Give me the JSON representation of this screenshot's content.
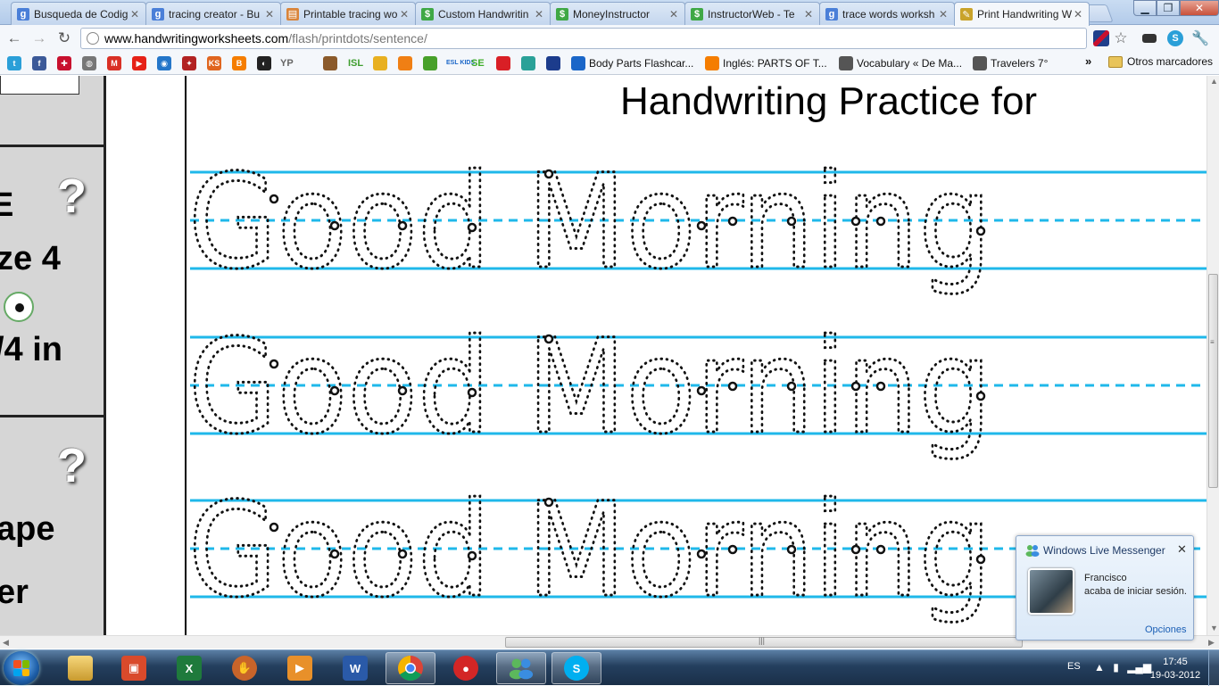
{
  "browser": {
    "tabs": [
      {
        "label": "Busqueda de Codig",
        "icon": "google-icon",
        "color": "#4a7fd8"
      },
      {
        "label": "tracing creator - Bu",
        "icon": "google-icon",
        "color": "#4a7fd8"
      },
      {
        "label": "Printable tracing wo",
        "icon": "worksheet-icon",
        "color": "#d9843a"
      },
      {
        "label": "Custom Handwritin",
        "icon": "dollar-icon",
        "color": "#3fa845"
      },
      {
        "label": "MoneyInstructor",
        "icon": "dollar-icon",
        "color": "#3fa845"
      },
      {
        "label": "InstructorWeb - Te",
        "icon": "dollar-icon",
        "color": "#3fa845"
      },
      {
        "label": "trace words worksh",
        "icon": "google-icon",
        "color": "#4a7fd8"
      },
      {
        "label": "Print Handwriting W",
        "icon": "pencil-icon",
        "color": "#c9a32a"
      }
    ],
    "active_tab": 7,
    "url_domain": "www.handwritingworksheets.com",
    "url_path": "/flash/printdots/sentence/",
    "bookmarks_icons": [
      {
        "name": "twitter-icon",
        "color": "#2a9fd8"
      },
      {
        "name": "facebook-icon",
        "color": "#3b5998"
      },
      {
        "name": "flag-uk-icon",
        "color": "#c8102e"
      },
      {
        "name": "globe-icon",
        "color": "#777777"
      },
      {
        "name": "gmail-icon",
        "color": "#d93025"
      },
      {
        "name": "youtube-icon",
        "color": "#e62117"
      },
      {
        "name": "bookmark-icon",
        "color": "#2476c9"
      },
      {
        "name": "bird-icon",
        "color": "#b22222"
      },
      {
        "name": "ks-icon",
        "color": "#e0651f"
      },
      {
        "name": "blogger-icon",
        "color": "#f57d00"
      },
      {
        "name": "badge-icon",
        "color": "#222222"
      }
    ],
    "bookmarks_text_icons": [
      {
        "label": "YP",
        "name": "yp-icon",
        "color": "#666666"
      },
      {
        "label": "ISL",
        "name": "isl-icon",
        "color": "#3f9e2f"
      },
      {
        "label": "ESL KIDS",
        "name": "esl-kids-icon",
        "color": "#1a66c8"
      },
      {
        "label": "SE",
        "name": "se-icon",
        "color": "#3fae2a"
      }
    ],
    "bookmarks_labeled": [
      {
        "label": "Body Parts Flashcar...",
        "name": "bookmark-body-parts",
        "color": "#1a66c8"
      },
      {
        "label": "Inglés: PARTS OF T...",
        "name": "bookmark-ingles",
        "color": "#f57d00"
      },
      {
        "label": "Vocabulary « De Ma...",
        "name": "bookmark-vocabulary",
        "color": "#555555"
      },
      {
        "label": "Travelers 7°",
        "name": "bookmark-travelers",
        "color": "#555555"
      }
    ],
    "other_bookmarks": "Otros marcadores"
  },
  "left_panel": {
    "text_e": "E",
    "text_size": "ze 4",
    "text_inch": "/4 in",
    "text_shape": "ape",
    "text_er": "er",
    "help": "?"
  },
  "worksheet": {
    "title": "Handwriting Practice for",
    "practice_text": "Good Morning",
    "line_color": "#1fb8ea"
  },
  "messenger": {
    "title": "Windows Live Messenger",
    "contact": "Francisco",
    "message": "acaba de iniciar sesión.",
    "options": "Opciones"
  },
  "taskbar": {
    "lang": "ES",
    "time": "17:45",
    "date": "19-03-2012"
  }
}
